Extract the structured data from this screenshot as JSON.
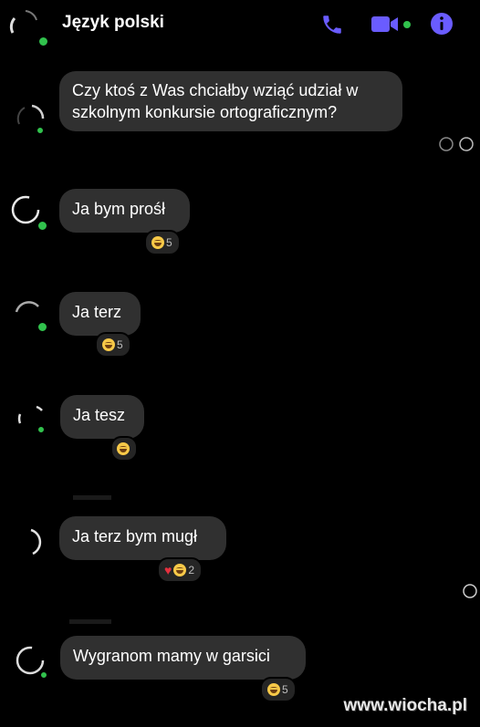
{
  "header": {
    "title": "Język polski",
    "icons": [
      "back-avatar",
      "phone-icon",
      "video-icon",
      "info-icon"
    ],
    "accent": "#6a5cff"
  },
  "messages": [
    {
      "text_lines": [
        "Czy ktoś z Was chciałby wziąć udział w",
        "szkolnym konkursie ortograficznym?"
      ],
      "reaction": null
    },
    {
      "text_lines": [
        "Ja bym prośł"
      ],
      "reaction": {
        "emojis": [
          "laugh"
        ],
        "count": "5"
      }
    },
    {
      "text_lines": [
        "Ja terz"
      ],
      "reaction": {
        "emojis": [
          "laugh"
        ],
        "count": "5"
      }
    },
    {
      "text_lines": [
        "Ja tesz"
      ],
      "reaction": {
        "emojis": [
          "laugh"
        ],
        "count": ""
      }
    },
    {
      "text_lines": [
        "Ja terz bym mugł"
      ],
      "reaction": {
        "emojis": [
          "heart",
          "laugh"
        ],
        "count": "2"
      }
    },
    {
      "text_lines": [
        "Wygranom mamy w garsici"
      ],
      "reaction": {
        "emojis": [
          "laugh"
        ],
        "count": "5"
      }
    }
  ],
  "watermark": "www.wiocha.pl",
  "colors": {
    "background": "#000000",
    "bubble": "#303030",
    "online": "#31c24d"
  }
}
